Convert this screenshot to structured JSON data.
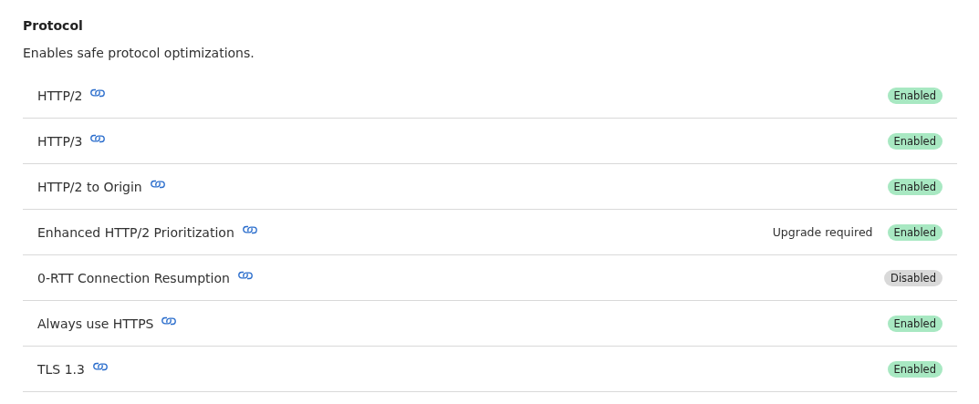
{
  "section": {
    "title": "Protocol",
    "description": "Enables safe protocol optimizations."
  },
  "settings": [
    {
      "name": "HTTP/2",
      "badge": "Enabled",
      "on": true
    },
    {
      "name": "HTTP/3",
      "badge": "Enabled",
      "on": true
    },
    {
      "name": "HTTP/2 to Origin",
      "badge": "Enabled",
      "on": true
    },
    {
      "name": "Enhanced HTTP/2 Prioritization",
      "note": "Upgrade required",
      "badge": "Enabled",
      "on": true
    },
    {
      "name": "0-RTT Connection Resumption",
      "badge": "Disabled",
      "on": false
    },
    {
      "name": "Always use HTTPS",
      "badge": "Enabled",
      "on": true
    },
    {
      "name": "TLS 1.3",
      "badge": "Enabled",
      "on": true
    }
  ]
}
